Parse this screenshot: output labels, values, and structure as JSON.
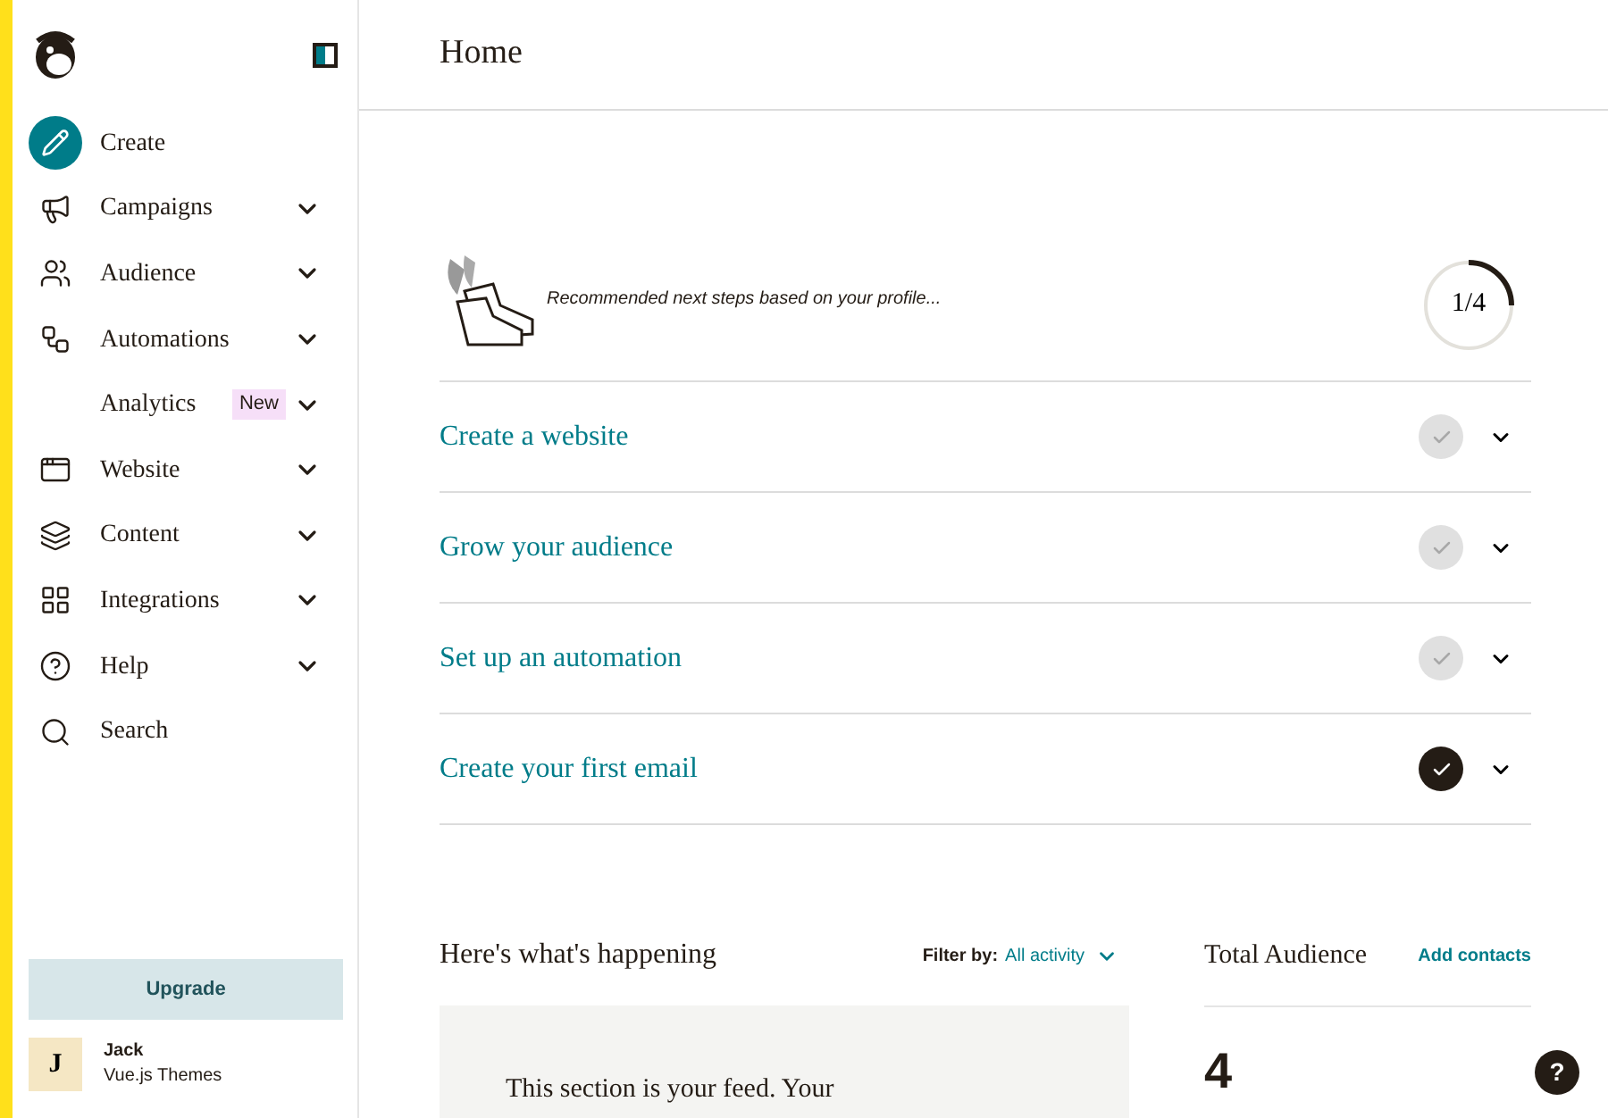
{
  "sidebar": {
    "items": [
      {
        "label": "Create",
        "kind": "create"
      },
      {
        "label": "Campaigns",
        "kind": "menu"
      },
      {
        "label": "Audience",
        "kind": "menu"
      },
      {
        "label": "Automations",
        "kind": "menu"
      },
      {
        "label": "Analytics",
        "kind": "menu",
        "badge": "New"
      },
      {
        "label": "Website",
        "kind": "menu"
      },
      {
        "label": "Content",
        "kind": "menu"
      },
      {
        "label": "Integrations",
        "kind": "menu"
      },
      {
        "label": "Help",
        "kind": "menu"
      },
      {
        "label": "Search",
        "kind": "link"
      }
    ],
    "upgrade": "Upgrade",
    "user": {
      "initial": "J",
      "name": "Jack",
      "org": "Vue.js Themes"
    }
  },
  "header": {
    "title": "Home"
  },
  "recommendations": {
    "intro": "Recommended next steps based on your profile...",
    "progress": "1/4",
    "level": 0.25,
    "steps": [
      {
        "label": "Create a website",
        "checked": false
      },
      {
        "label": "Grow your audience",
        "checked": false
      },
      {
        "label": "Set up an automation",
        "checked": false
      },
      {
        "label": "Create your first email",
        "checked": true
      }
    ]
  },
  "feed": {
    "title": "Here's what's happening",
    "filter_label": "Filter by:",
    "filter_value": "All activity",
    "text": "This section is your feed. Your"
  },
  "audience": {
    "title": "Total Audience",
    "action": "Add contacts",
    "count": "4"
  },
  "help_button": "?"
}
